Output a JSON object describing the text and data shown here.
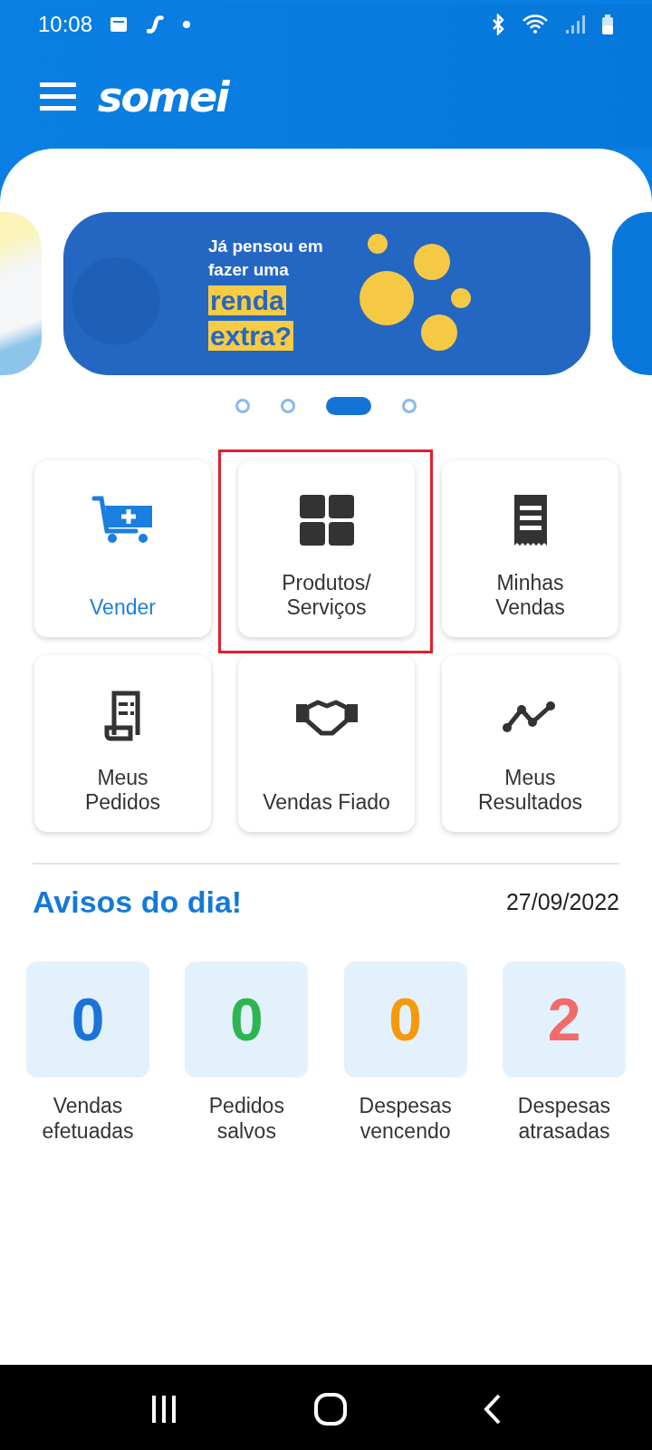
{
  "status_bar": {
    "time": "10:08"
  },
  "header": {
    "logo": "somei"
  },
  "carousel": {
    "banner": {
      "lines": [
        "Já pensou em",
        "fazer uma"
      ],
      "highlight": [
        "renda",
        "extra?"
      ]
    },
    "dots": [
      {
        "selected": false
      },
      {
        "selected": false
      },
      {
        "selected": true
      },
      {
        "selected": false
      }
    ]
  },
  "menu": [
    {
      "label": "Vender",
      "kind": "cart",
      "accent": true,
      "highlighted": false
    },
    {
      "label": "Produtos/\nServiços",
      "kind": "grid",
      "accent": false,
      "highlighted": true
    },
    {
      "label": "Minhas\nVendas",
      "kind": "receipt",
      "accent": false,
      "highlighted": false
    },
    {
      "label": "Meus\nPedidos",
      "kind": "order",
      "accent": false,
      "highlighted": false
    },
    {
      "label": "Vendas Fiado",
      "kind": "handshake",
      "accent": false,
      "highlighted": false
    },
    {
      "label": "Meus\nResultados",
      "kind": "chart",
      "accent": false,
      "highlighted": false
    }
  ],
  "notices": {
    "title": "Avisos do dia!",
    "date": "27/09/2022",
    "stats": [
      {
        "value": "0",
        "label": "Vendas efetuadas",
        "color": "#1a73d9"
      },
      {
        "value": "0",
        "label": "Pedidos salvos",
        "color": "#2db552"
      },
      {
        "value": "0",
        "label": "Despesas vencendo",
        "color": "#f59a0c"
      },
      {
        "value": "2",
        "label": "Despesas atrasadas",
        "color": "#f26a6a"
      }
    ]
  }
}
